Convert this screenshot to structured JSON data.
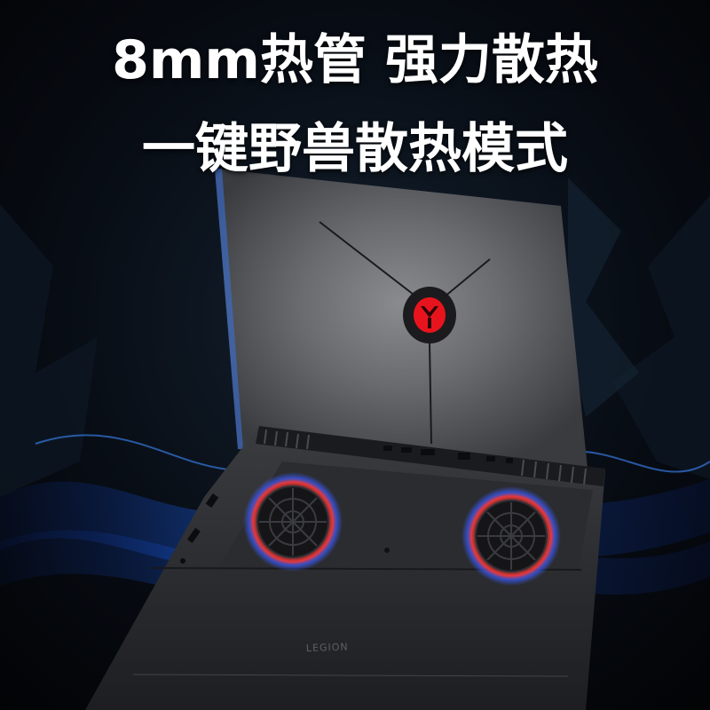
{
  "headline": {
    "line1": "8mm热管  强力散热",
    "line2": "一键野兽散热模式"
  },
  "product": {
    "bottom_logo_text": "LEGION"
  },
  "colors": {
    "background": "#05070c",
    "wave_blue": "#1e6cff",
    "fan_ring_red": "#ff3a3a",
    "logo_red": "#e8141d",
    "lid_gray": "#5c5d61"
  },
  "icons": {
    "lid_logo": "legion-y-logo-icon",
    "fan_left": "fan-icon",
    "fan_right": "fan-icon"
  }
}
